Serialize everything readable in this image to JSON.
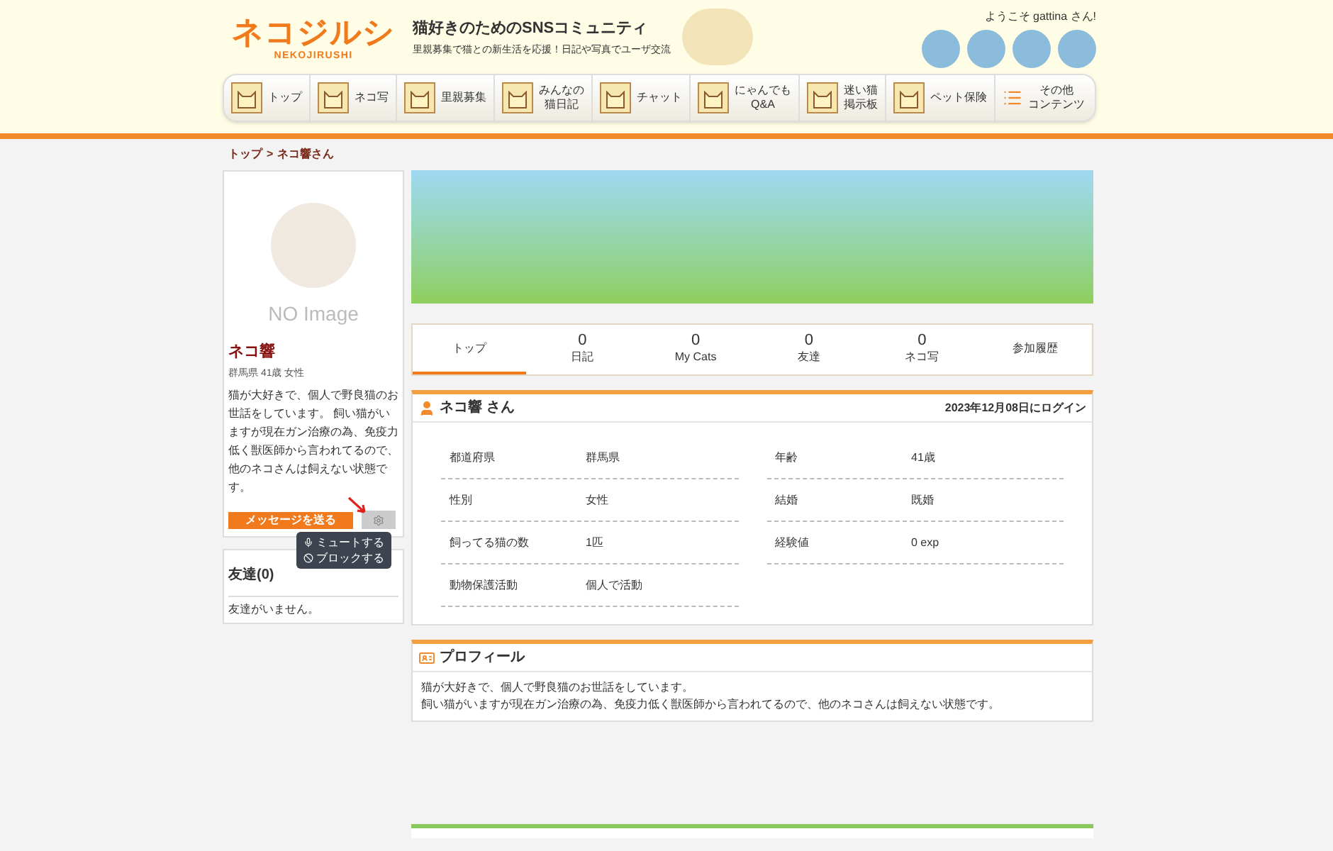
{
  "header": {
    "logo": "ネコジルシ",
    "logo_sub": "NEKOJIRUSHI",
    "tagline": "猫好きのためのSNSコミュニティ",
    "subtagline": "里親募集で猫との新生活を応援！日記や写真でユーザ交流",
    "welcome": "ようこそ gattina さん!"
  },
  "nav": [
    {
      "lines": [
        "トップ"
      ],
      "kind": "cat"
    },
    {
      "lines": [
        "ネコ写"
      ],
      "kind": "cat"
    },
    {
      "lines": [
        "里親募集"
      ],
      "kind": "cat"
    },
    {
      "lines": [
        "みんなの",
        "猫日記"
      ],
      "kind": "cat"
    },
    {
      "lines": [
        "チャット"
      ],
      "kind": "cat"
    },
    {
      "lines": [
        "にゃんでも",
        "Q&A"
      ],
      "kind": "cat"
    },
    {
      "lines": [
        "迷い猫",
        "掲示板"
      ],
      "kind": "cat"
    },
    {
      "lines": [
        "ペット保険"
      ],
      "kind": "cat"
    },
    {
      "lines": [
        "その他",
        "コンテンツ"
      ],
      "kind": "list"
    }
  ],
  "breadcrumb": {
    "link": "トップ",
    "separator": ">",
    "current": "ネコ響さん"
  },
  "profile_card": {
    "no_image": "NO Image",
    "name": "ネコ響",
    "meta": "群馬県 41歳 女性",
    "bio": "猫が大好きで、個人で野良猫のお世話をしています。 飼い猫がいますが現在ガン治療の為、免疫力低く獣医師から言われてるので、他のネコさんは飼えない状態です。",
    "message_button": "メッセージを送る",
    "menu": [
      "ミュートする",
      "ブロックする"
    ]
  },
  "friends": {
    "title": "友達(0)",
    "empty": "友達がいません。"
  },
  "tabs": [
    {
      "label": "トップ",
      "selected": true
    },
    {
      "count": "0",
      "label": "日記",
      "selected": false
    },
    {
      "count": "0",
      "label": "My Cats",
      "selected": false
    },
    {
      "count": "0",
      "label": "友達",
      "selected": false
    },
    {
      "count": "0",
      "label": "ネコ写",
      "selected": false
    },
    {
      "label": "参加履歴",
      "selected": false
    }
  ],
  "info": {
    "title": "ネコ響 さん",
    "last_login": "2023年12月08日にログイン",
    "fields": [
      {
        "label": "都道府県",
        "value": "群馬県"
      },
      {
        "label": "年齢",
        "value": "41歳"
      },
      {
        "label": "性別",
        "value": "女性"
      },
      {
        "label": "結婚",
        "value": "既婚"
      },
      {
        "label": "飼ってる猫の数",
        "value": "1匹"
      },
      {
        "label": "経験値",
        "value": "0 exp"
      },
      {
        "label": "動物保護活動",
        "value": "個人で活動"
      }
    ]
  },
  "profile": {
    "title": "プロフィール",
    "lines": [
      "猫が大好きで、個人で野良猫のお世話をしています。",
      "飼い猫がいますが現在ガン治療の為、免疫力低く獣医師から言われてるので、他のネコさんは飼えない状態です。"
    ]
  }
}
